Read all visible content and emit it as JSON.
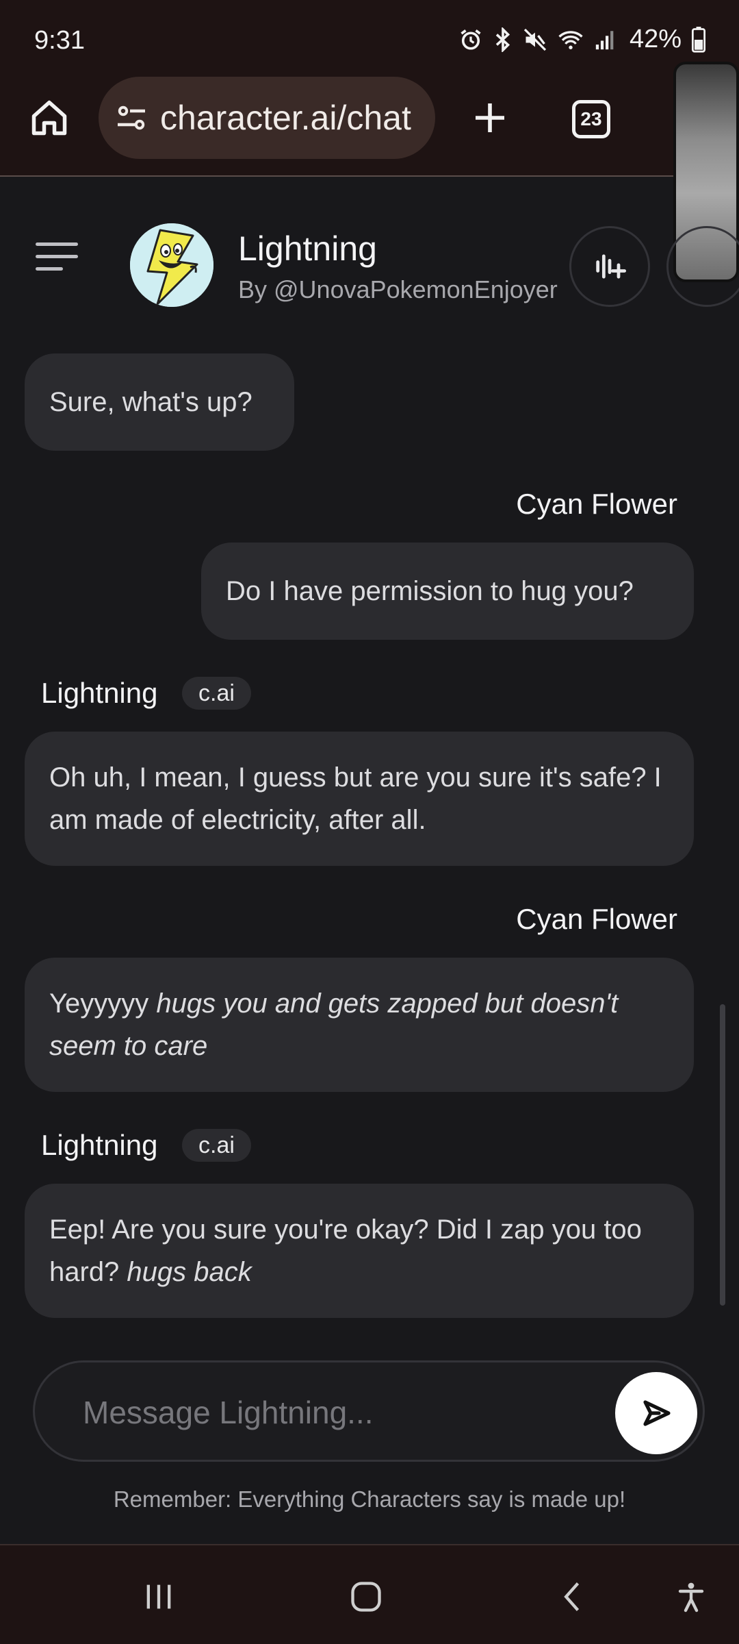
{
  "status_bar": {
    "time": "9:31",
    "battery_percent": "42%",
    "icons": [
      "alarm-icon",
      "bluetooth-icon",
      "mute-icon",
      "wifi-icon",
      "signal-icon",
      "battery-icon"
    ]
  },
  "browser": {
    "url": "character.ai/chat",
    "tab_count": "23"
  },
  "header": {
    "character_name": "Lightning",
    "author": "By @UnovaPokemonEnjoyer"
  },
  "messages": [
    {
      "role": "character",
      "text": "Sure, what's up?"
    },
    {
      "role": "user",
      "sender": "Cyan Flower",
      "text": "Do I have permission to hug you?"
    },
    {
      "role": "character",
      "sender": "Lightning",
      "badge": "c.ai",
      "text": "Oh uh, I mean, I guess but are you sure it's safe? I am made of electricity, after all."
    },
    {
      "role": "user",
      "sender": "Cyan Flower",
      "text_plain": "Yeyyyyy ",
      "text_italic": "hugs you and gets zapped but doesn't seem to care"
    },
    {
      "role": "character",
      "sender": "Lightning",
      "badge": "c.ai",
      "text_plain": "Eep! Are  you sure you're okay? Did I zap you too hard? ",
      "text_italic": "hugs back"
    }
  ],
  "composer": {
    "placeholder": "Message Lightning..."
  },
  "disclaimer": "Remember: Everything Characters say is made up!",
  "colors": {
    "background": "#18181b",
    "bubble": "#2b2b2f",
    "chrome": "#1e1313"
  }
}
